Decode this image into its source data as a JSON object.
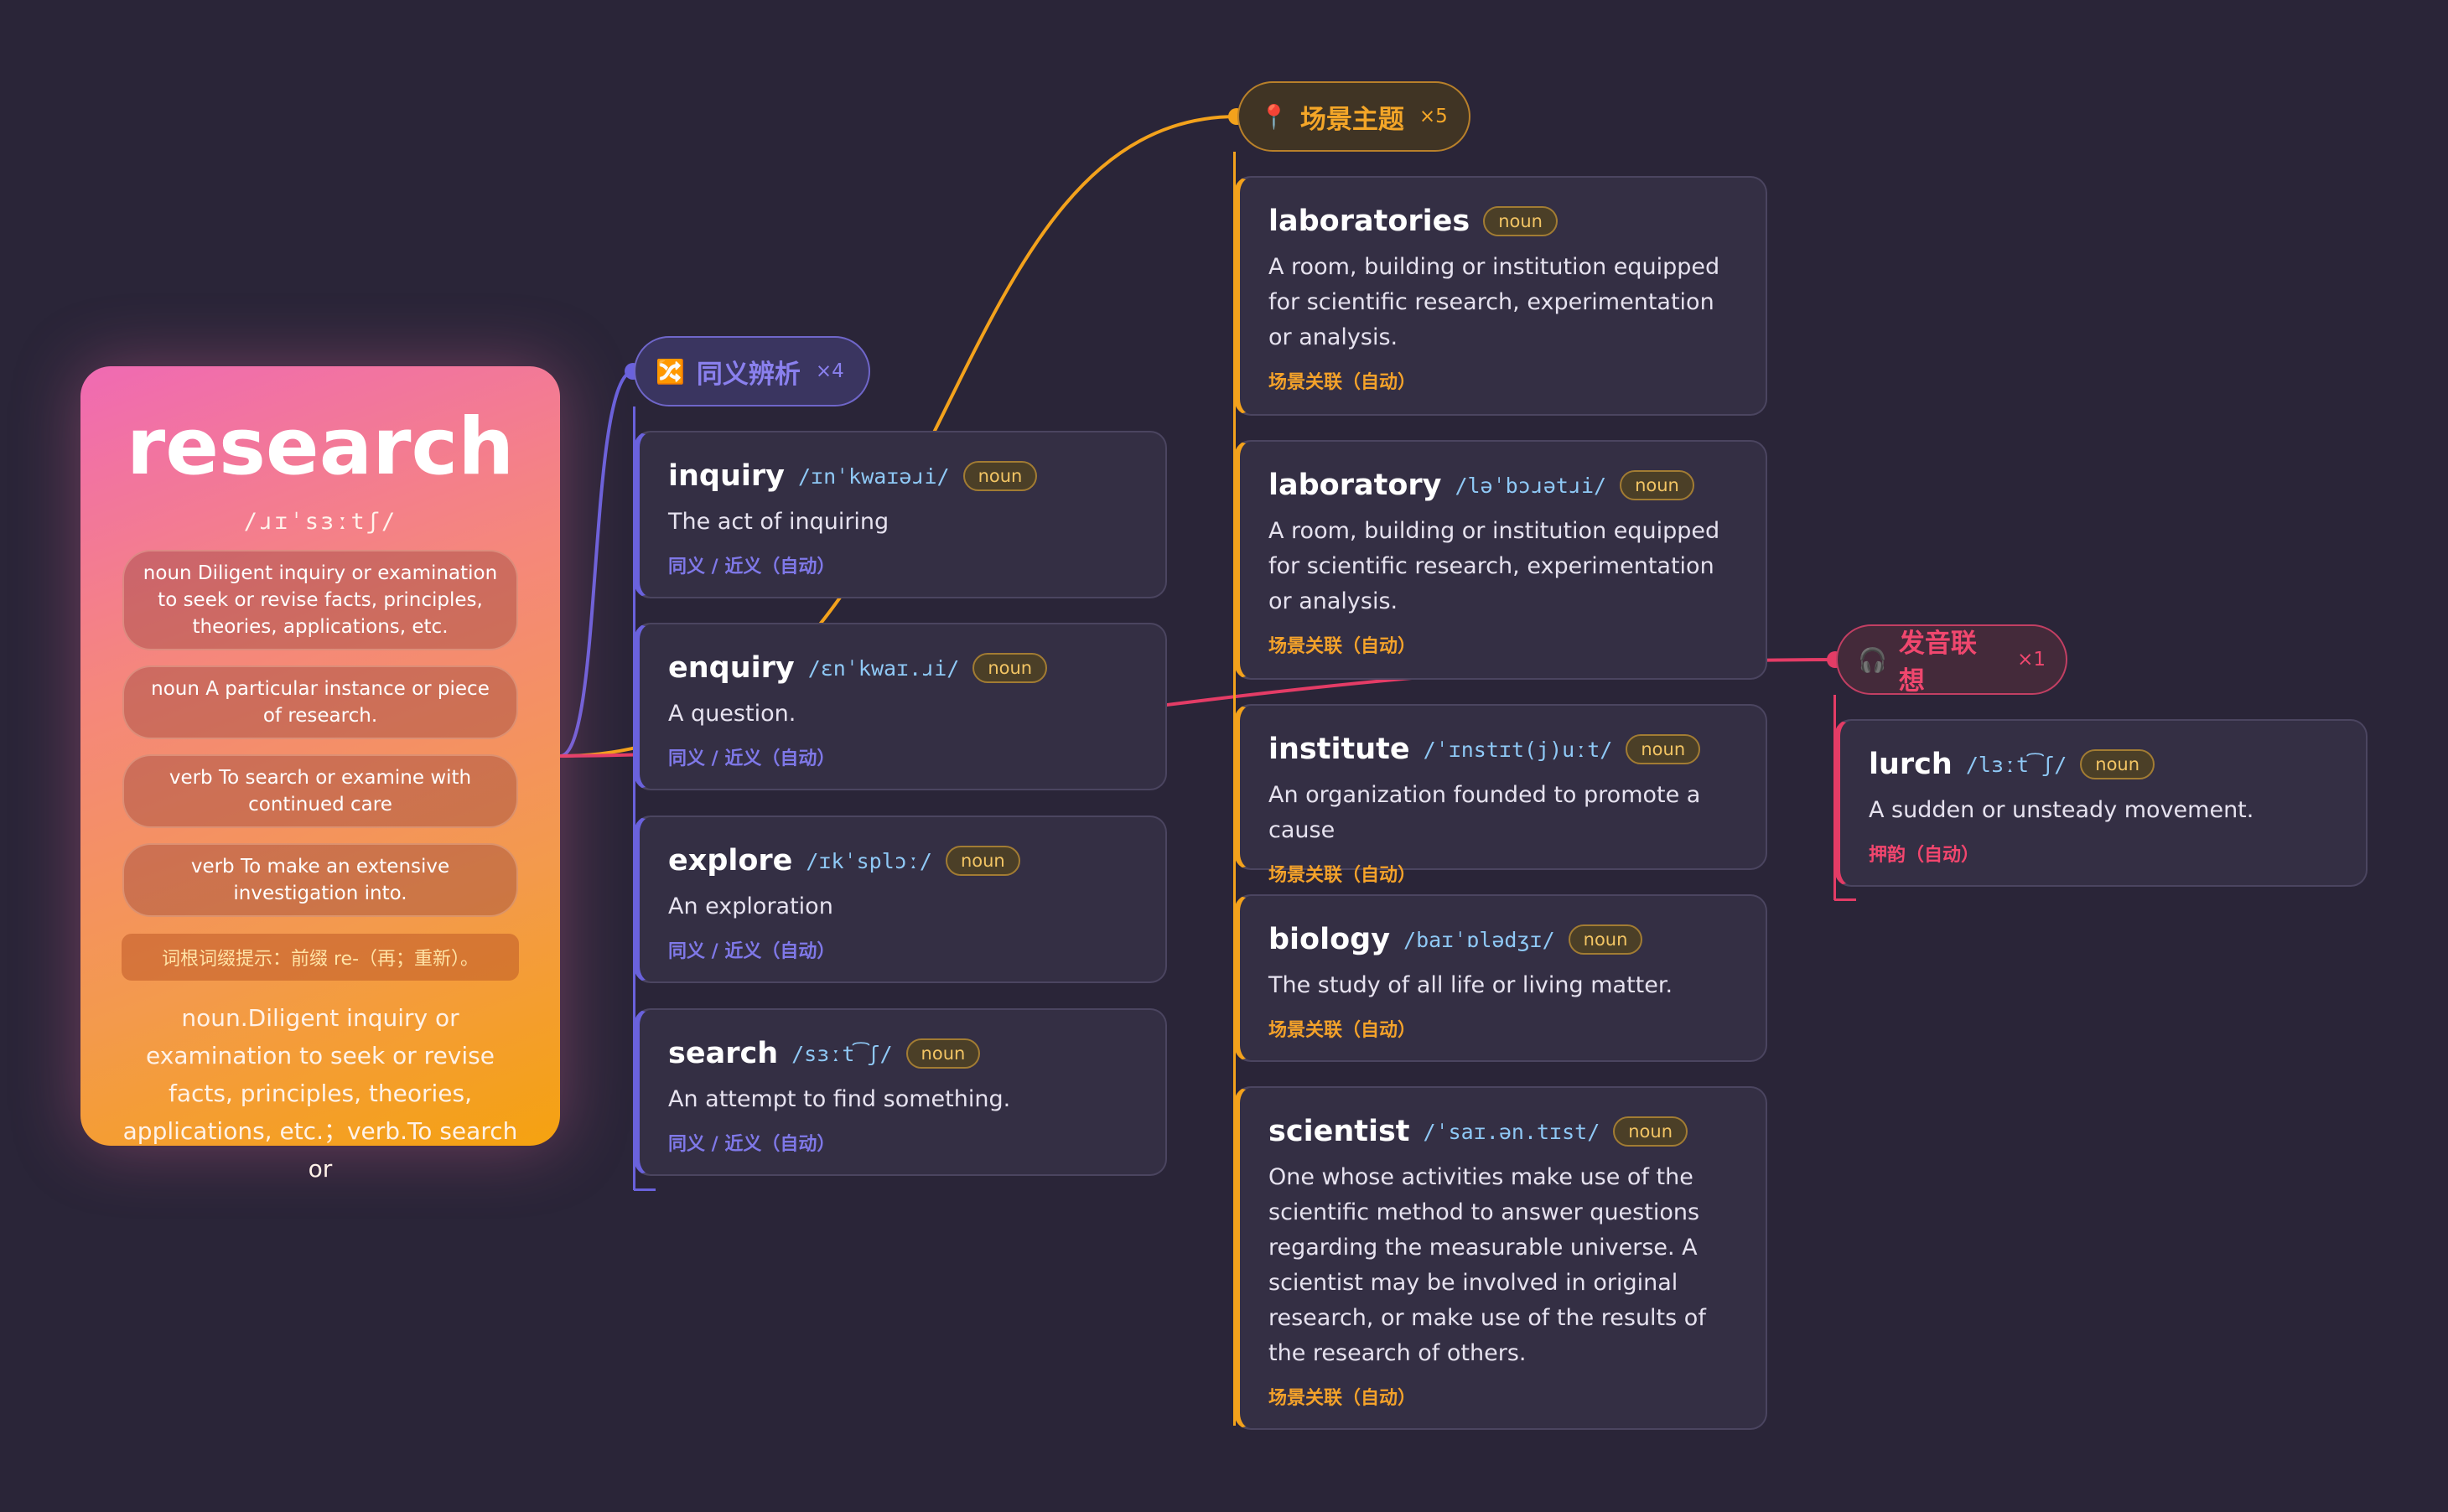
{
  "main": {
    "word": "research",
    "ipa": "/ɹɪˈsɜːtʃ/",
    "definitions": [
      "noun Diligent inquiry or examination to seek or revise facts, principles, theories, applications, etc.",
      "noun A particular instance or piece of research.",
      "verb To search or examine with continued care",
      "verb To make an extensive investigation into."
    ],
    "root_hint": "词根词缀提示：前缀 re-（再；重新）。",
    "summary": "noun.Diligent inquiry or examination to seek or revise facts, principles, theories, applications, etc.；verb.To search or"
  },
  "groups": {
    "synonyms": {
      "title": "同义辨析",
      "count": "×4",
      "icon": "shuffle-icon",
      "color": "#6a62dc",
      "items": [
        {
          "word": "inquiry",
          "ipa": "/ɪnˈkwaɪəɹi/",
          "pos": "noun",
          "def": "The act of inquiring",
          "tag": "同义 / 近义（自动）"
        },
        {
          "word": "enquiry",
          "ipa": "/ɛnˈkwaɪ.ɹi/",
          "pos": "noun",
          "def": "A question.",
          "tag": "同义 / 近义（自动）"
        },
        {
          "word": "explore",
          "ipa": "/ɪkˈsplɔː/",
          "pos": "noun",
          "def": "An exploration",
          "tag": "同义 / 近义（自动）"
        },
        {
          "word": "search",
          "ipa": "/sɜːt͡ʃ/",
          "pos": "noun",
          "def": "An attempt to find something.",
          "tag": "同义 / 近义（自动）"
        }
      ]
    },
    "scene": {
      "title": "场景主题",
      "count": "×5",
      "icon": "pin-icon",
      "color": "#f3a21c",
      "items": [
        {
          "word": "laboratories",
          "ipa": "",
          "pos": "noun",
          "def": "A room, building or institution equipped for scientific research, experimentation or analysis.",
          "tag": "场景关联（自动）"
        },
        {
          "word": "laboratory",
          "ipa": "/ləˈbɔɹətɹi/",
          "pos": "noun",
          "def": "A room, building or institution equipped for scientific research, experimentation or analysis.",
          "tag": "场景关联（自动）"
        },
        {
          "word": "institute",
          "ipa": "/ˈɪnstɪt(j)uːt/",
          "pos": "noun",
          "def": "An organization founded to promote a cause",
          "tag": "场景关联（自动）"
        },
        {
          "word": "biology",
          "ipa": "/baɪˈɒlədʒɪ/",
          "pos": "noun",
          "def": "The study of all life or living matter.",
          "tag": "场景关联（自动）"
        },
        {
          "word": "scientist",
          "ipa": "/ˈsaɪ.ən.tɪst/",
          "pos": "noun",
          "def": "One whose activities make use of the scientific method to answer questions regarding the measurable universe. A scientist may be involved in original research, or make use of the results of the research of others.",
          "tag": "场景关联（自动）"
        }
      ]
    },
    "sound": {
      "title": "发音联想",
      "count": "×1",
      "icon": "headphones-icon",
      "color": "#e43c66",
      "items": [
        {
          "word": "lurch",
          "ipa": "/lɜːt͡ʃ/",
          "pos": "noun",
          "def": "A sudden or unsteady movement.",
          "tag": "押韵（自动）"
        }
      ]
    }
  }
}
